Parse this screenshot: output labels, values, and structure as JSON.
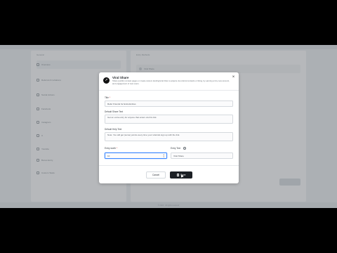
{
  "background": {
    "left_section_label": "General",
    "sidebar_items": [
      {
        "label": "Overview",
        "icon": "grid-icon"
      },
      {
        "label": "Referral & Invitations",
        "icon": "users-icon"
      },
      {
        "label": "Social Actions",
        "icon": "share-icon"
      },
      {
        "label": "Facebook",
        "icon": "facebook-icon"
      },
      {
        "label": "Instagram",
        "icon": "instagram-icon"
      },
      {
        "label": "X",
        "icon": "x-icon"
      },
      {
        "label": "Youtube",
        "icon": "youtube-icon"
      },
      {
        "label": "Bonus Entry",
        "icon": "gift-icon"
      },
      {
        "label": "Custom Tasks",
        "icon": "check-icon"
      }
    ],
    "right_section_label": "Entry Methods",
    "right_row_label": "Viral Share"
  },
  "modal": {
    "title": "Viral Share",
    "description": "Share (public) contest pages or create custom landing/viral links to acquire via referral contacts or liking, by earning a tiny new amount, and engagement of new users.",
    "close_label": "×",
    "fields": {
      "title_label": "Title",
      "title_required": "*",
      "title_value": "Refer Friends for Extra Entries",
      "default_share_text_label": "Default Share Text",
      "default_share_text_value": "Get an extra entry for anyone that enters via this link.",
      "default_help_text_label": "Default Help Text",
      "default_help_text_value": "Note: You will get (some) points every time your referrals sign up with the link.",
      "entry_worth_label": "Entry worth",
      "entry_worth_required": "*",
      "entry_worth_value": "10",
      "entry_text_label": "Entry Text",
      "entry_text_value": "Viral Share"
    },
    "cancel_label": "Cancel",
    "save_label": "Save"
  },
  "footer_text": "© 2024 · All rights reserved"
}
